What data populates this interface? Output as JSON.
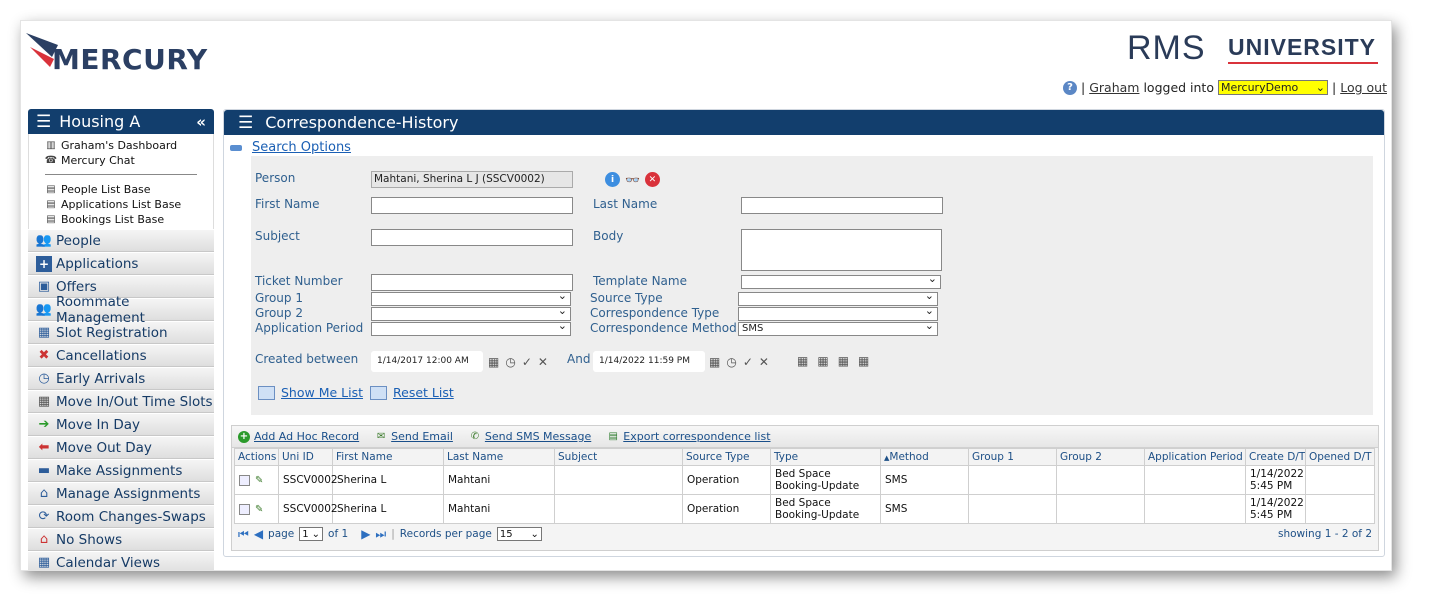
{
  "brand": {
    "left_logo": "MERCURY",
    "rms": "RMS",
    "university": "UNIVERSITY"
  },
  "userbar": {
    "user": "Graham",
    "logged_into": "logged into",
    "environment": "MercuryDemo",
    "logout": "Log out",
    "separator": "|"
  },
  "sidebar": {
    "title": "Housing A",
    "links": [
      {
        "label": "Graham's Dashboard",
        "icon": "chart-icon"
      },
      {
        "label": "Mercury Chat",
        "icon": "phone-icon"
      },
      {
        "label": "People List Base",
        "icon": "document-icon"
      },
      {
        "label": "Applications List Base",
        "icon": "document-icon"
      },
      {
        "label": "Bookings List Base",
        "icon": "document-icon"
      }
    ],
    "items": [
      {
        "label": "People",
        "icon": "people-icon"
      },
      {
        "label": "Applications",
        "icon": "add-form-icon"
      },
      {
        "label": "Offers",
        "icon": "offer-icon"
      },
      {
        "label": "Roommate Management",
        "icon": "people-icon"
      },
      {
        "label": "Slot Registration",
        "icon": "registration-icon"
      },
      {
        "label": "Cancellations",
        "icon": "cancel-icon"
      },
      {
        "label": "Early Arrivals",
        "icon": "clock-icon"
      },
      {
        "label": "Move In/Out Time Slots",
        "icon": "calendar-grid-icon"
      },
      {
        "label": "Move In Day",
        "icon": "arrow-right-icon"
      },
      {
        "label": "Move Out Day",
        "icon": "arrow-left-icon"
      },
      {
        "label": "Make Assignments",
        "icon": "bed-icon"
      },
      {
        "label": "Manage Assignments",
        "icon": "home-icon"
      },
      {
        "label": "Room Changes-Swaps",
        "icon": "swap-icon"
      },
      {
        "label": "No Shows",
        "icon": "no-show-icon"
      },
      {
        "label": "Calendar Views",
        "icon": "calendar-icon"
      }
    ]
  },
  "main": {
    "title": "Correspondence-History",
    "search_options_label": "Search Options",
    "form": {
      "person_label": "Person",
      "person_value": "Mahtani, Sherina L J (SSCV0002)",
      "first_name_label": "First Name",
      "last_name_label": "Last Name",
      "subject_label": "Subject",
      "body_label": "Body",
      "ticket_label": "Ticket Number",
      "template_label": "Template Name",
      "group1_label": "Group 1",
      "source_type_label": "Source Type",
      "group2_label": "Group 2",
      "corr_type_label": "Correspondence Type",
      "app_period_label": "Application Period",
      "corr_method_label": "Correspondence Method",
      "corr_method_value": "SMS",
      "created_between_label": "Created between",
      "and_label": "And",
      "date_from": "1/14/2017 12:00 AM",
      "date_to": "1/14/2022 11:59 PM",
      "show_list": "Show Me List",
      "reset_list": "Reset List"
    },
    "toolbar": {
      "add_record": "Add Ad Hoc Record",
      "send_email": "Send Email",
      "send_sms": "Send SMS Message",
      "export": "Export correspondence list"
    },
    "table": {
      "columns": [
        "Actions",
        "Uni ID",
        "First Name",
        "Last Name",
        "Subject",
        "Source Type",
        "Type",
        "Method",
        "Group 1",
        "Group 2",
        "Application Period",
        "Create D/T",
        "Opened D/T"
      ],
      "sort_indicator": "▲",
      "rows": [
        {
          "uni_id": "SSCV0002",
          "first": "Sherina L",
          "last": "Mahtani",
          "subject": "",
          "source": "Operation",
          "type": "Bed Space Booking-Update",
          "method": "SMS",
          "g1": "",
          "g2": "",
          "period": "",
          "created": "1/14/2022 5:45 PM",
          "opened": ""
        },
        {
          "uni_id": "SSCV0002",
          "first": "Sherina L",
          "last": "Mahtani",
          "subject": "",
          "source": "Operation",
          "type": "Bed Space Booking-Update",
          "method": "SMS",
          "g1": "",
          "g2": "",
          "period": "",
          "created": "1/14/2022 5:45 PM",
          "opened": ""
        }
      ]
    },
    "pager": {
      "page_label": "page",
      "page_value": "1",
      "of_label": "of 1",
      "records_label": "Records per page",
      "records_value": "15",
      "showing": "showing 1 - 2 of 2"
    }
  }
}
